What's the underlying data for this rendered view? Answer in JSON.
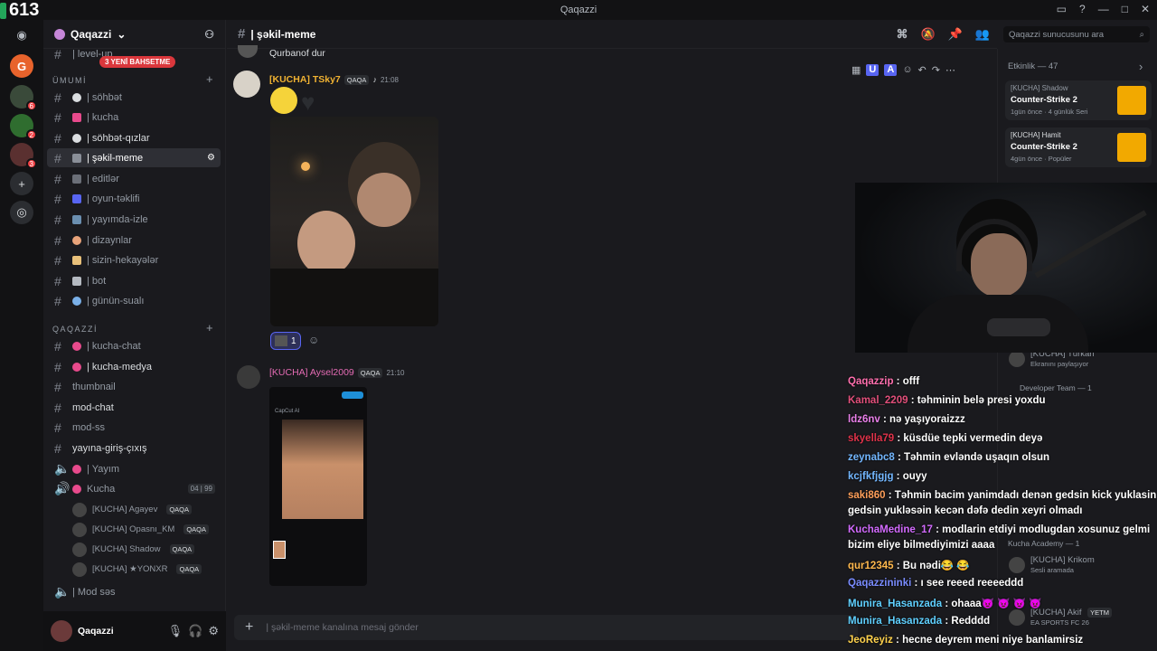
{
  "window": {
    "title": "Qaqazzi"
  },
  "overlay": {
    "viewer_count": "613"
  },
  "servers": [
    {
      "badge": ""
    },
    {
      "badge": ""
    },
    {
      "badge": "6"
    },
    {
      "badge": "2"
    },
    {
      "badge": "3"
    }
  ],
  "sidebar": {
    "server_name": "Qaqazzi",
    "new_mentions_pill": "3 YENİ BAHSETME",
    "category_umumi": "ÜMUMİ",
    "category_qaqazzi": "QAQAZZİ",
    "channels": [
      {
        "label": "| level-up"
      },
      {
        "label": "| söhbət"
      },
      {
        "label": "| kucha"
      },
      {
        "label": "| söhbət-qızlar"
      },
      {
        "label": "| şəkil-meme"
      },
      {
        "label": "| editlər"
      },
      {
        "label": "| oyun-təklifi"
      },
      {
        "label": "| yayımda-izle"
      },
      {
        "label": "| dizaynlar"
      },
      {
        "label": "| sizin-hekayələr"
      },
      {
        "label": "| bot"
      },
      {
        "label": "| günün-sualı"
      }
    ],
    "channels2": [
      {
        "label": "| kucha-chat"
      },
      {
        "label": "| kucha-medya"
      },
      {
        "label": "thumbnail"
      },
      {
        "label": "mod-chat"
      },
      {
        "label": "mod-ss"
      },
      {
        "label": "yayına-giriş-çıxış"
      },
      {
        "label": "| Yayım"
      },
      {
        "label": "Kucha"
      }
    ],
    "voice_count": "04",
    "voice_limit": "99",
    "voice_users": [
      {
        "name": "[KUCHA] Agayev",
        "tag": "QAQA"
      },
      {
        "name": "[KUCHA] Opasnı_KM",
        "tag": "QAQA"
      },
      {
        "name": "[KUCHA] Shadow",
        "tag": "QAQA"
      },
      {
        "name": "[KUCHA] ★YONXR",
        "tag": "QAQA"
      }
    ],
    "last_channel": "| Mod səs"
  },
  "user": {
    "name": "Qaqazzi"
  },
  "channel": {
    "name": "| şəkil-meme",
    "composer_placeholder": "| şəkil-meme kanalına mesaj gönder"
  },
  "search": {
    "placeholder": "Qaqazzi sunucusunu ara"
  },
  "messages": {
    "prev_text": "Qurbanof dur",
    "m1": {
      "author": "[KUCHA] TSky7",
      "tag": "QAQA",
      "time": "21:08",
      "reaction_count": "1"
    },
    "m2": {
      "author": "[KUCHA] Aysel2009",
      "tag": "QAQA",
      "time": "21:10",
      "capcut_label": "CapCut AI"
    }
  },
  "activity": {
    "title": "Etkinlik — 47",
    "items": [
      {
        "user": "[KUCHA] Shadow",
        "game": "Counter-Strike 2",
        "meta": "1gün önce · 4 günlük Seri"
      },
      {
        "user": "[KUCHA] Hamit",
        "game": "Counter-Strike 2",
        "meta": "4gün önce · Popüler"
      }
    ]
  },
  "members": {
    "turkan": "[KUCHA] Türkan",
    "turkan_status": "Ekranını paylaşıyor",
    "dev_team": "Developer Team — 1",
    "kucha_academy": "Kucha Academy — 1",
    "krikom": "[KUCHA] Krikom",
    "krikom_status": "Sesli aramada",
    "akif": "[KUCHA] Akif",
    "akif_status": "EA SPORTS FC 26",
    "akif_tag": "YETM"
  },
  "chat": [
    {
      "user": "Qaqazzip",
      "text": ": offf",
      "color": "#ff6fae"
    },
    {
      "user": "Kamal_2209",
      "text": ": təhminin belə presi yoxdu",
      "color": "#e14f7a"
    },
    {
      "user": "ldz6nv",
      "text": ": nə yaşıyoraizzz",
      "color": "#e87fe8"
    },
    {
      "user": "skyella79",
      "text": ": küsdüe tepki vermedin deyə",
      "color": "#e0334a"
    },
    {
      "user": "zeynabc8",
      "text": ": Təhmin evləndə uşaqın olsun",
      "color": "#73b7ff"
    },
    {
      "user": "kcjfkfjgjg",
      "text": ": ouyy",
      "color": "#73b7ff"
    },
    {
      "user": "saki860",
      "text": ": Təhmin bacim yanimdadı denən gedsin kick yuklasin adi",
      "color": "#ff9f5a"
    },
    {
      "user": "",
      "text": "gedsin yukləsəin kecən dəfə dedin xeyri olmadı",
      "color": "#ffffff"
    },
    {
      "user": "KuchaMedine_17",
      "text": ": modlarin etdiyi modlugdan xosunuz gelmi",
      "color": "#d36bff"
    },
    {
      "user": "",
      "text": "bizim eliye bilmediyimizi aaaa",
      "color": "#ffffff"
    },
    {
      "user": "qur12345",
      "text": ": Bu nədi😂 😂",
      "color": "#ffb84d"
    },
    {
      "user": "Qaqazzininki",
      "text": ": ı see reeed reeeeddd",
      "color": "#7a8cff"
    },
    {
      "user": "Munira_Hasanzada",
      "text": ": ohaaa😈 😈 😈 😈",
      "color": "#5fd0ff"
    },
    {
      "user": "Munira_Hasanzada",
      "text": ": Redddd",
      "color": "#5fd0ff"
    },
    {
      "user": "JeoReyiz",
      "text": ": hecne deyrem meni niye banlamirsiz",
      "color": "#ffd24d"
    }
  ]
}
